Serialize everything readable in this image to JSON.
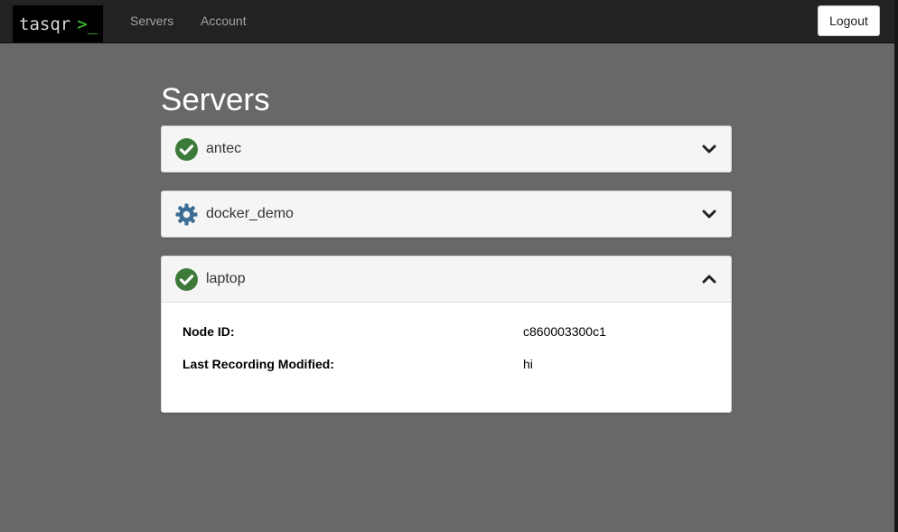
{
  "brand": {
    "text": "tasqr",
    "prompt": ">_"
  },
  "nav": {
    "servers": "Servers",
    "account": "Account",
    "logout": "Logout"
  },
  "page": {
    "title": "Servers"
  },
  "servers": [
    {
      "name": "antec",
      "status": "ok",
      "icon": "check-circle-icon",
      "expanded": false
    },
    {
      "name": "docker_demo",
      "status": "busy",
      "icon": "gear-icon",
      "expanded": false
    },
    {
      "name": "laptop",
      "status": "ok",
      "icon": "check-circle-icon",
      "expanded": true,
      "details": [
        {
          "label": "Node ID:",
          "value": "c860003300c1"
        },
        {
          "label": "Last Recording Modified:",
          "value": "hi"
        }
      ]
    }
  ],
  "colors": {
    "ok": "#3d7a3a",
    "busy": "#3b6e96",
    "navbar": "#222222",
    "background": "#686868"
  }
}
